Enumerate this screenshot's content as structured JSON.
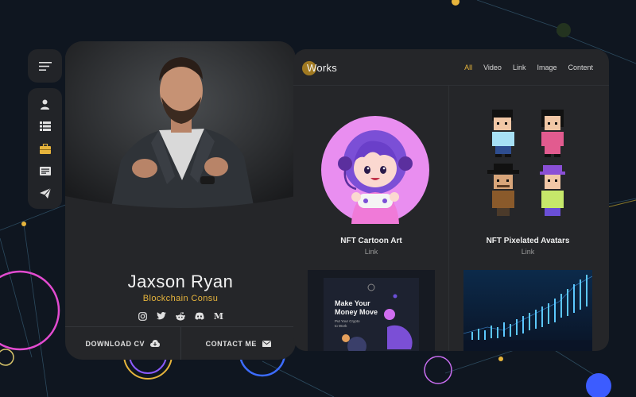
{
  "profile": {
    "name": "Jaxson Ryan",
    "role": "Blockchain Consu",
    "socials": [
      "instagram-icon",
      "twitter-icon",
      "reddit-icon",
      "discord-icon",
      "medium-icon"
    ],
    "medium_glyph": "M",
    "actions": {
      "download_label": "DOWNLOAD CV",
      "contact_label": "CONTACT ME"
    }
  },
  "nav": {
    "items": [
      "user-icon",
      "list-icon",
      "briefcase-icon",
      "card-icon",
      "send-icon"
    ],
    "active": "briefcase-icon"
  },
  "works": {
    "title": "Works",
    "filters": [
      "All",
      "Video",
      "Link",
      "Image",
      "Content"
    ],
    "active_filter": "All",
    "items": [
      {
        "title": "NFT Cartoon Art",
        "link": "Link"
      },
      {
        "title": "NFT Pixelated Avatars",
        "link": "Link"
      }
    ],
    "promo": {
      "heading_line1": "Make Your",
      "heading_line2": "Money Move",
      "sub_line1": "Put Your Crypto",
      "sub_line2": "to Work"
    }
  },
  "colors": {
    "accent": "#e6b43c",
    "background": "#0f1620",
    "card": "#252629"
  }
}
